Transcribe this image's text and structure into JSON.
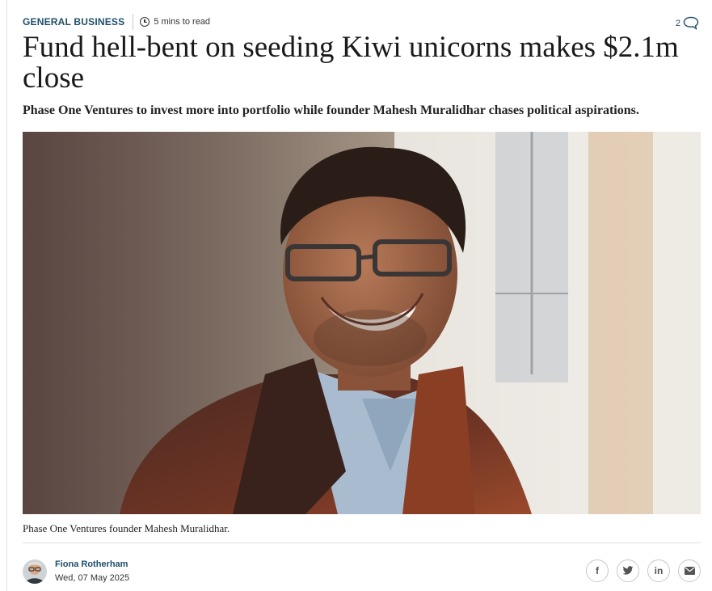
{
  "article": {
    "category": "GENERAL BUSINESS",
    "read_time": "5 mins to read",
    "comment_count": "2",
    "headline": "Fund hell-bent on seeding Kiwi unicorns makes $2.1m close",
    "standfirst": "Phase One Ventures to invest more into portfolio while founder Mahesh Muralidhar chases political aspirations.",
    "image_caption": "Phase One Ventures founder Mahesh Muralidhar."
  },
  "byline": {
    "author": "Fiona Rotherham",
    "date": "Wed, 07 May 2025"
  },
  "share": {
    "facebook_glyph": "f",
    "linkedin_glyph": "in",
    "icons": [
      "facebook-icon",
      "twitter-icon",
      "linkedin-icon",
      "email-icon"
    ]
  },
  "colors": {
    "accent": "#1f4e6b",
    "text": "#1a1a1a",
    "border": "#c8c8c8"
  }
}
